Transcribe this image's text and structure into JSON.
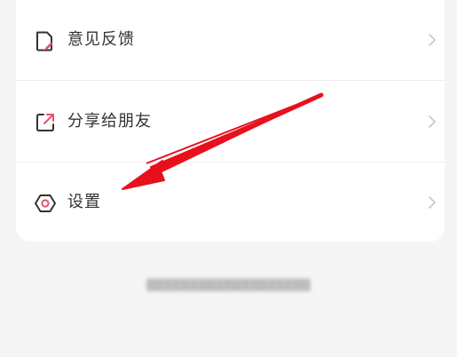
{
  "menu": {
    "items": [
      {
        "label": "意见反馈",
        "icon": "feedback-document-icon"
      },
      {
        "label": "分享给朋友",
        "icon": "share-icon"
      },
      {
        "label": "设置",
        "icon": "settings-hexagon-icon"
      }
    ]
  },
  "colors": {
    "accent": "#e8516e",
    "icon_stroke": "#333333",
    "chevron": "#c7c7c7",
    "arrow": "#e8101c"
  }
}
